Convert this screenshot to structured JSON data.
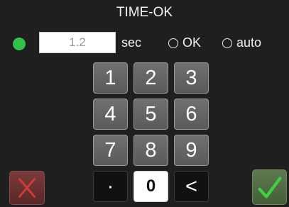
{
  "header": {
    "title": "TIME-OK"
  },
  "settings": {
    "status_color": "#31c24a",
    "value": "1.2",
    "unit": "sec",
    "options": [
      {
        "label": "OK",
        "selected": false
      },
      {
        "label": "auto",
        "selected": false
      }
    ]
  },
  "keypad": {
    "keys": [
      "1",
      "2",
      "3",
      "4",
      "5",
      "6",
      "7",
      "8",
      "9",
      "·",
      "0",
      "<"
    ]
  },
  "actions": {
    "cancel_icon": "x-icon",
    "cancel_color": "#d23a3a",
    "confirm_icon": "checkmark-icon",
    "confirm_color": "#3fcf3f"
  }
}
